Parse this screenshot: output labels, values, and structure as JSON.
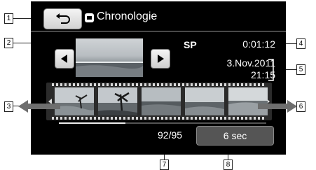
{
  "header": {
    "title": "Chronologie"
  },
  "info": {
    "mode": "SP",
    "duration": "0:01:12",
    "date": "3.Nov.2011",
    "time": "21:15"
  },
  "footer": {
    "counter": "92/95",
    "interval": "6 sec"
  },
  "callouts": {
    "c1": "1",
    "c2": "2",
    "c3": "3",
    "c4": "4",
    "c5": "5",
    "c6": "6",
    "c7": "7",
    "c8": "8"
  },
  "icons": {
    "back": "return-arrow-icon",
    "prev": "triangle-left-icon",
    "next": "triangle-right-icon",
    "scroll_left": "arrow-left-icon",
    "scroll_right": "arrow-right-icon"
  },
  "colors": {
    "screen": "#000000",
    "button": "#e2e2e2",
    "text": "#ffffff"
  }
}
